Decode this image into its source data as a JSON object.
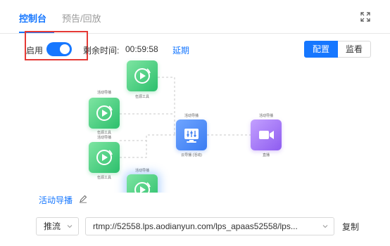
{
  "tabs": [
    {
      "label": "控制台",
      "active": true
    },
    {
      "label": "预告/回放",
      "active": false
    }
  ],
  "icons": {
    "expand": "expand-icon",
    "edit": "edit-pencil-icon",
    "chevron": "chevron-down-icon"
  },
  "controls": {
    "enable_label": "启用",
    "enabled": true,
    "remain_label": "剩余时间:",
    "remain_value": "00:59:58",
    "extend_label": "延期"
  },
  "view_toggle": {
    "config_label": "配置",
    "monitor_label": "监看",
    "selected": "config"
  },
  "colors": {
    "accent": "#1677ff",
    "highlight": "#e53935",
    "node_green": "#2cbf6c",
    "node_blue": "#3a7cf2",
    "node_purple": "#8e5cf0"
  },
  "flow": {
    "nodes": [
      {
        "id": "src1",
        "label_top": "",
        "label_bottom": "伍源工具"
      },
      {
        "id": "src2",
        "label_top": "活动导播",
        "label_bottom": "伍源工具"
      },
      {
        "id": "src3",
        "label_top": "活动导播",
        "label_bottom": "伍源工具"
      },
      {
        "id": "src4",
        "label_top": "活动导播",
        "label_bottom": ""
      },
      {
        "id": "director",
        "label_top": "活动导播",
        "label_bottom": "云导播 (活动)"
      },
      {
        "id": "live",
        "label_top": "活动导播",
        "label_bottom": "直播"
      }
    ]
  },
  "active_director_label": "活动导播",
  "push": {
    "mode_value": "推流",
    "url_value": "rtmp://52558.lps.aodianyun.com/lps_apaas52558/lps...",
    "copy_label": "复制"
  }
}
